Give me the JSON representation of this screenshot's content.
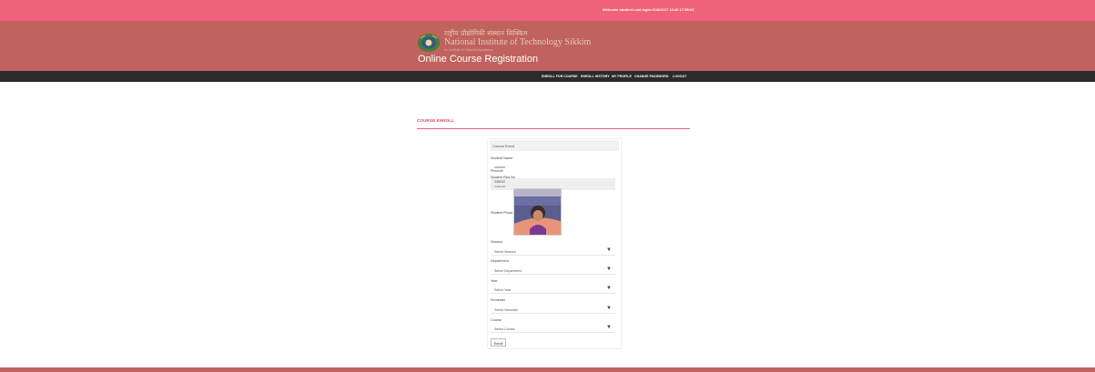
{
  "topbar": {
    "welcome_text": "Welcome student    Last login:21/6/2017 13:48 17:55:00"
  },
  "header": {
    "hindi_name": "राष्ट्रीय प्रौद्योगिकी संस्थान सिक्किम",
    "institute_name": "National Institute of Technology Sikkim",
    "subline": "An Institute of National Importance",
    "site_title": "Online Course Registration"
  },
  "nav": {
    "enroll": "ENROLL FOR COURSE",
    "history": "ENROLL HISTORY",
    "profile": "MY PROFILE",
    "change_password": "CHANGE PASSWORD",
    "logout": "LOGOUT"
  },
  "page": {
    "title": "COURSE ENROLL"
  },
  "form": {
    "heading": "Course Enroll",
    "student_name_label": "Student Name",
    "student_name_value": "sraham",
    "reg_no_label": "Student Reg No",
    "reg_no_value": "133230",
    "pincode_label": "Pincode",
    "pincode_value": "338942",
    "photo_label": "Student Photo",
    "session_label": "Session",
    "session_value": "Select Session",
    "department_label": "Department",
    "department_value": "Select Department",
    "year_label": "Year",
    "year_value": "Select Year",
    "semester_label": "Semester",
    "semester_value": "Select Semester",
    "course_label": "Course",
    "course_value": "Select Course",
    "submit_label": "Enroll"
  },
  "colors": {
    "topbar": "#f0627a",
    "header": "#c0625e",
    "navbar": "#2b2b2b",
    "accent": "#e0465f"
  }
}
